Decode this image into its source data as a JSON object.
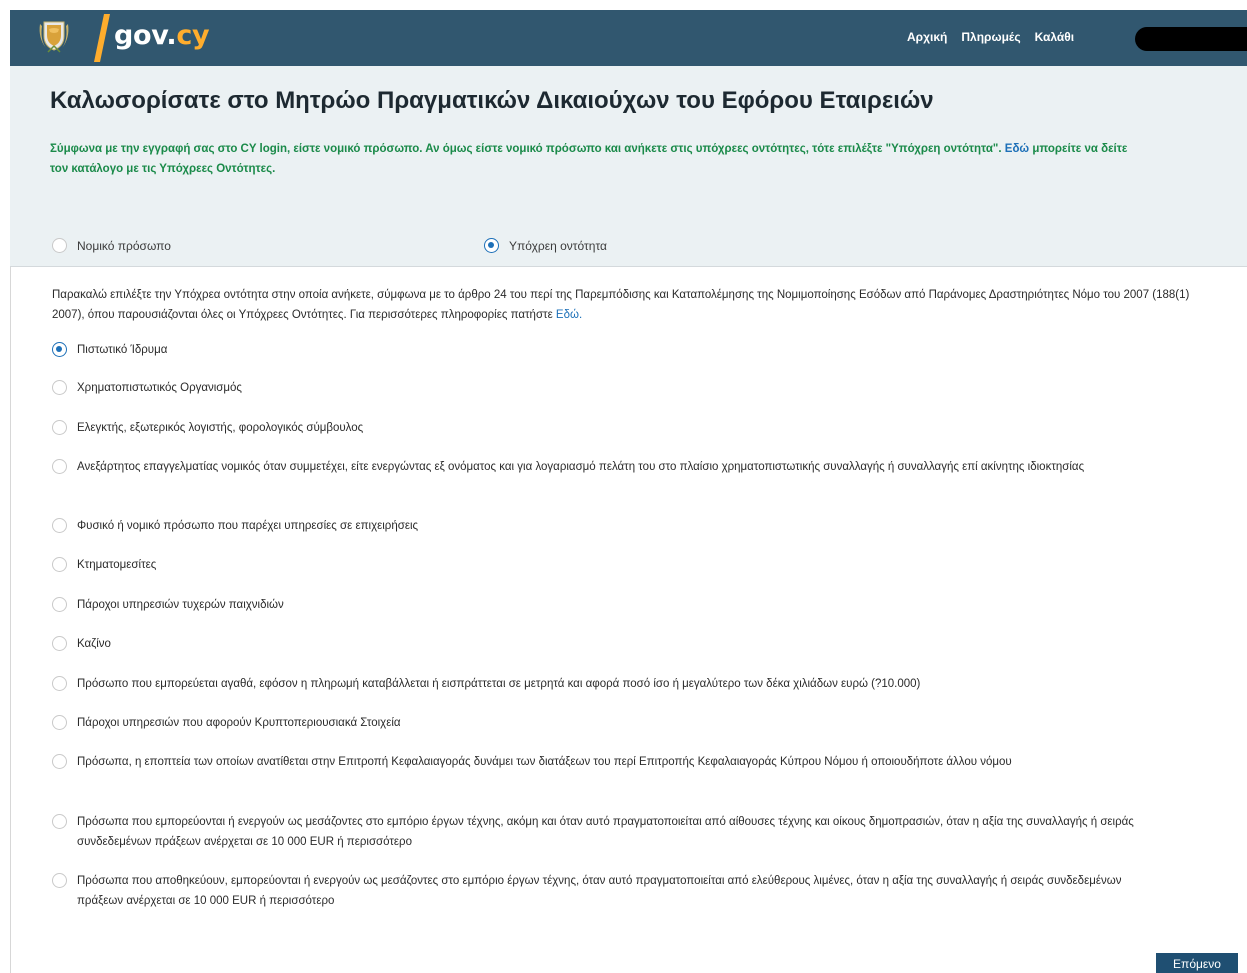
{
  "header": {
    "logo_name": "gov.",
    "logo_tld": "cy",
    "nav": [
      "Αρχική",
      "Πληρωμές",
      "Καλάθι"
    ]
  },
  "welcome": {
    "title": "Καλωσορίσατε στο Μητρώο Πραγματικών Δικαιούχων του Εφόρου Εταιρειών",
    "intro_text": "Σύμφωνα με την εγγραφή σας στο CY login, είστε νομικό πρόσωπο. Αν όμως είστε νομικό πρόσωπο και ανήκετε στις υπόχρεες οντότητες, τότε επιλέξτε \"Υπόχρεη οντότητα\".",
    "intro_link": "Εδώ",
    "intro_after_link": "μπορείτε να δείτε τον κατάλογο με τις Υπόχρεες Οντότητες.",
    "entity_options": [
      {
        "label": "Νομικό πρόσωπο",
        "selected": false
      },
      {
        "label": "Υπόχρεη οντότητα",
        "selected": true
      }
    ]
  },
  "body": {
    "instruction": "Παρακαλώ επιλέξτε την Υπόχρεα οντότητα στην οποία ανήκετε, σύμφωνα με το άρθρο 24 του περί της Παρεμπόδισης και Καταπολέμησης της Νομιμοποίησης Εσόδων από Παράνομες Δραστηριότητες Νόμο του 2007 (188(1) 2007), όπου παρουσιάζονται όλες οι Υπόχρεες Οντότητες. Για περισσότερες πληροφορίες πατήστε",
    "instruction_link": "Εδώ.",
    "options": [
      {
        "label": "Πιστωτικό Ίδρυμα",
        "selected": true
      },
      {
        "label": "Χρηματοπιστωτικός Οργανισμός",
        "selected": false
      },
      {
        "label": "Ελεγκτής, εξωτερικός λογιστής, φορολογικός σύμβουλος",
        "selected": false
      },
      {
        "label": "Ανεξάρτητος επαγγελματίας νομικός όταν συμμετέχει, είτε ενεργώντας εξ ονόματος και για λογαριασμό πελάτη του στο πλαίσιο χρηματοπιστωτικής συναλλαγής ή συναλλαγής επί ακίνητης ιδιοκτησίας",
        "selected": false
      },
      {
        "label": "Φυσικό ή νομικό πρόσωπο που παρέχει υπηρεσίες σε επιχειρήσεις",
        "selected": false
      },
      {
        "label": "Κτηματομεσίτες",
        "selected": false
      },
      {
        "label": "Πάροχοι υπηρεσιών τυχερών παιχνιδιών",
        "selected": false
      },
      {
        "label": "Καζίνο",
        "selected": false
      },
      {
        "label": "Πρόσωπο που εμπορεύεται αγαθά, εφόσον η πληρωμή καταβάλλεται ή εισπράττεται σε μετρητά και αφορά ποσό ίσο ή μεγαλύτερο των δέκα χιλιάδων ευρώ (?10.000)",
        "selected": false
      },
      {
        "label": "Πάροχοι υπηρεσιών που αφορούν Κρυπτοπεριουσιακά Στοιχεία",
        "selected": false
      },
      {
        "label": "Πρόσωπα, η εποπτεία των οποίων ανατίθεται στην Επιτροπή Κεφαλαιαγοράς δυνάμει των διατάξεων του περί Επιτροπής Κεφαλαιαγοράς Κύπρου Νόμου ή οποιουδήποτε άλλου νόμου",
        "selected": false
      },
      {
        "label": "Πρόσωπα που εμπορεύονται ή ενεργούν ως μεσάζοντες στο εμπόριο έργων τέχνης, ακόμη και όταν αυτό πραγματοποιείται από αίθουσες τέχνης και οίκους δημοπρασιών, όταν η αξία της συναλλαγής ή σειράς συνδεδεμένων πράξεων ανέρχεται σε 10 000 EUR ή περισσότερο",
        "selected": false
      },
      {
        "label": "Πρόσωπα που αποθηκεύουν, εμπορεύονται ή ενεργούν ως μεσάζοντες στο εμπόριο έργων τέχνης, όταν αυτό πραγματοποιείται από ελεύθερους λιμένες, όταν η αξία της συναλλαγής ή σειράς συνδεδεμένων πράξεων ανέρχεται σε 10 000 EUR ή περισσότερο",
        "selected": false
      }
    ],
    "next_label": "Επόμενο"
  }
}
